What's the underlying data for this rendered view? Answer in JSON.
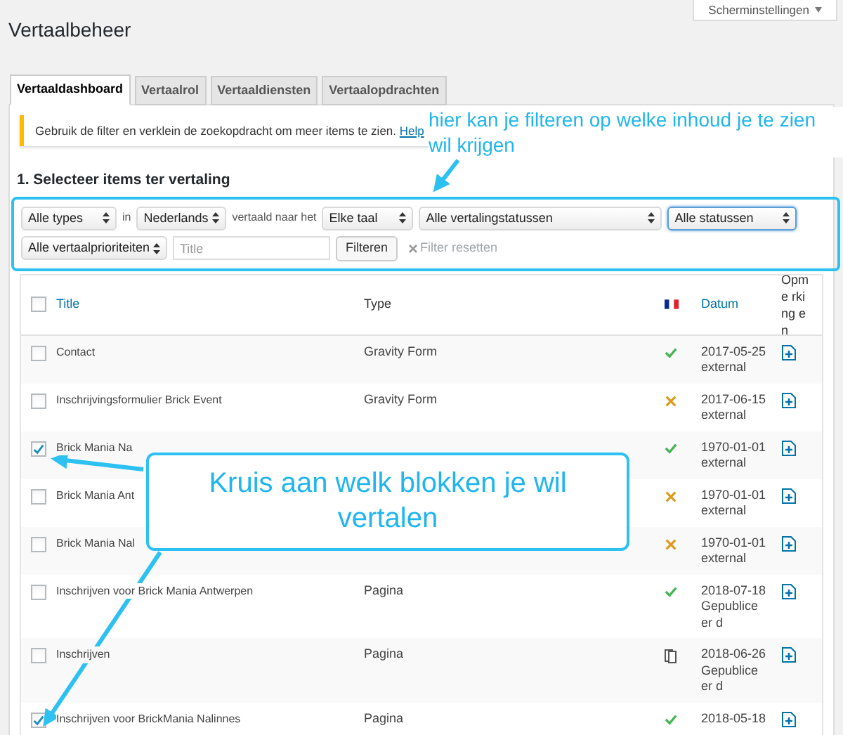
{
  "page_title": "Vertaalbeheer",
  "screen_options": {
    "label": "Scherminstellingen"
  },
  "tabs": [
    {
      "label": "Vertaaldashboard",
      "selected": true
    },
    {
      "label": "Vertaalrol",
      "selected": false
    },
    {
      "label": "Vertaaldiensten",
      "selected": false
    },
    {
      "label": "Vertaalopdrachten",
      "selected": false
    }
  ],
  "notice": {
    "text": "Gebruik de filter en verklein de zoekopdracht om meer items te zien.",
    "link": "Help"
  },
  "section_heading": "1. Selecteer items ter vertaling",
  "filters": [
    {
      "kind": "select",
      "value": "Alle types",
      "focused": false
    },
    {
      "kind": "text",
      "value": "in"
    },
    {
      "kind": "select",
      "value": "Nederlands",
      "focused": false
    },
    {
      "kind": "text",
      "value": "vertaald naar het"
    },
    {
      "kind": "select",
      "value": "Elke taal",
      "focused": false
    },
    {
      "kind": "select",
      "value": "Alle vertalingstatussen",
      "focused": false
    },
    {
      "kind": "select",
      "value": "Alle statussen",
      "focused": true
    },
    {
      "kind": "break"
    },
    {
      "kind": "select",
      "value": "Alle vertaalprioriteiten",
      "focused": false
    },
    {
      "kind": "input",
      "placeholder": "Title"
    },
    {
      "kind": "button",
      "value": "Filteren"
    },
    {
      "kind": "reset",
      "value": "Filter resetten"
    }
  ],
  "table": {
    "columns": {
      "title": "Title",
      "type": "Type",
      "date": "Datum",
      "notes": "Opme rking en"
    },
    "header_checked": false,
    "rows": [
      {
        "title": "Contact",
        "type": "Gravity Form",
        "kind": "translated",
        "date": "2017-05-25",
        "state": "external",
        "checked": false
      },
      {
        "title": "Inschrijvingsformulier Brick Event",
        "type": "Gravity Form",
        "kind": "outdated",
        "date": "2017-06-15",
        "state": "external",
        "checked": false
      },
      {
        "title": "Brick Mania Na",
        "kind": "translated",
        "date": "1970-01-01",
        "state": "external",
        "checked": true
      },
      {
        "title": "Brick Mania Ant",
        "kind": "outdated",
        "date": "1970-01-01",
        "state": "external",
        "checked": false
      },
      {
        "title": "Brick Mania Nal",
        "kind": "outdated",
        "date": "1970-01-01",
        "state": "external",
        "checked": false
      },
      {
        "title": "Inschrijven voor Brick Mania Antwerpen",
        "type": "Pagina",
        "kind": "translated",
        "date": "2018-07-18",
        "state": "Gepubliceer d",
        "checked": false
      },
      {
        "title": "Inschrijven",
        "type": "Pagina",
        "kind": "duplicate",
        "date": "2018-06-26",
        "state": "Gepubliceer d",
        "checked": false
      },
      {
        "title": "Inschrijven voor BrickMania Nalinnes",
        "type": "Pagina",
        "kind": "translated",
        "date": "2018-05-18",
        "checked": true
      }
    ]
  },
  "annotations": [
    {
      "kind": "note",
      "text": "hier kan je filteren op welke inhoud je te zien wil krijgen"
    },
    {
      "kind": "callout",
      "text": "Kruis aan welk blokken je wil vertalen"
    }
  ]
}
